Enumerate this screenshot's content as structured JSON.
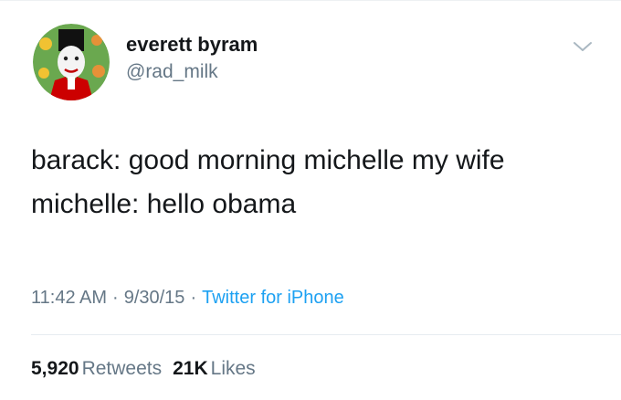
{
  "author": {
    "display_name": "everett byram",
    "handle": "@rad_milk",
    "avatar_icon": "avatar-portrait"
  },
  "menu": {
    "icon": "chevron-down-icon"
  },
  "tweet": {
    "lines": [
      "barack: good morning michelle my wife",
      "michelle: hello obama"
    ]
  },
  "meta": {
    "time": "11:42 AM",
    "date": "9/30/15",
    "separator": "·",
    "source": "Twitter for iPhone"
  },
  "stats": {
    "retweets_count": "5,920",
    "retweets_label": "Retweets",
    "likes_count": "21K",
    "likes_label": "Likes"
  },
  "colors": {
    "text": "#14171a",
    "secondary": "#657786",
    "link": "#1da1f2",
    "divider": "#e6ecf0"
  }
}
